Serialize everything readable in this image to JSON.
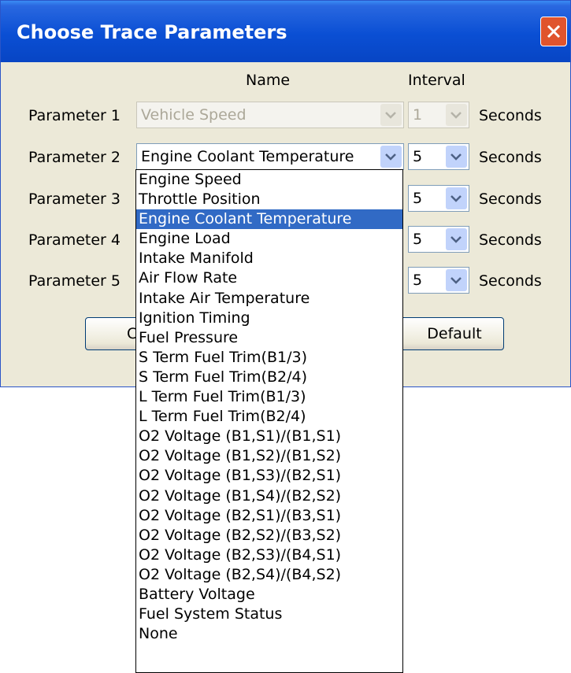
{
  "title": "Choose Trace Parameters",
  "headers": {
    "name": "Name",
    "interval": "Interval"
  },
  "rows": [
    {
      "label": "Parameter 1",
      "name": "Vehicle Speed",
      "interval": "1",
      "unit": "Seconds",
      "disabled": true
    },
    {
      "label": "Parameter 2",
      "name": "Engine Coolant Temperature",
      "interval": "5",
      "unit": "Seconds"
    },
    {
      "label": "Parameter 3",
      "name": "",
      "interval": "5",
      "unit": "Seconds"
    },
    {
      "label": "Parameter 4",
      "name": "",
      "interval": "5",
      "unit": "Seconds"
    },
    {
      "label": "Parameter 5",
      "name": "",
      "interval": "5",
      "unit": "Seconds"
    }
  ],
  "buttons": {
    "ok_partial": "C",
    "default": "Default"
  },
  "dropdown": {
    "selected_index": 2,
    "items": [
      "Engine Speed",
      "Throttle Position",
      "Engine Coolant Temperature",
      "Engine Load",
      "Intake Manifold",
      "Air Flow Rate",
      "Intake Air Temperature",
      "Ignition Timing",
      "Fuel Pressure",
      "S Term Fuel Trim(B1/3)",
      "S Term Fuel Trim(B2/4)",
      "L Term Fuel Trim(B1/3)",
      "L Term Fuel Trim(B2/4)",
      "O2 Voltage (B1,S1)/(B1,S1)",
      "O2 Voltage (B1,S2)/(B1,S2)",
      "O2 Voltage (B1,S3)/(B2,S1)",
      "O2 Voltage (B1,S4)/(B2,S2)",
      "O2 Voltage (B2,S1)/(B3,S1)",
      "O2 Voltage (B2,S2)/(B3,S2)",
      "O2 Voltage (B2,S3)/(B4,S1)",
      "O2 Voltage (B2,S4)/(B4,S2)",
      "Battery Voltage",
      "Fuel System Status",
      "None"
    ]
  },
  "colors": {
    "titlebar": "#0a4fd4",
    "selection": "#316ac5",
    "dialog_bg": "#ece9d8"
  }
}
